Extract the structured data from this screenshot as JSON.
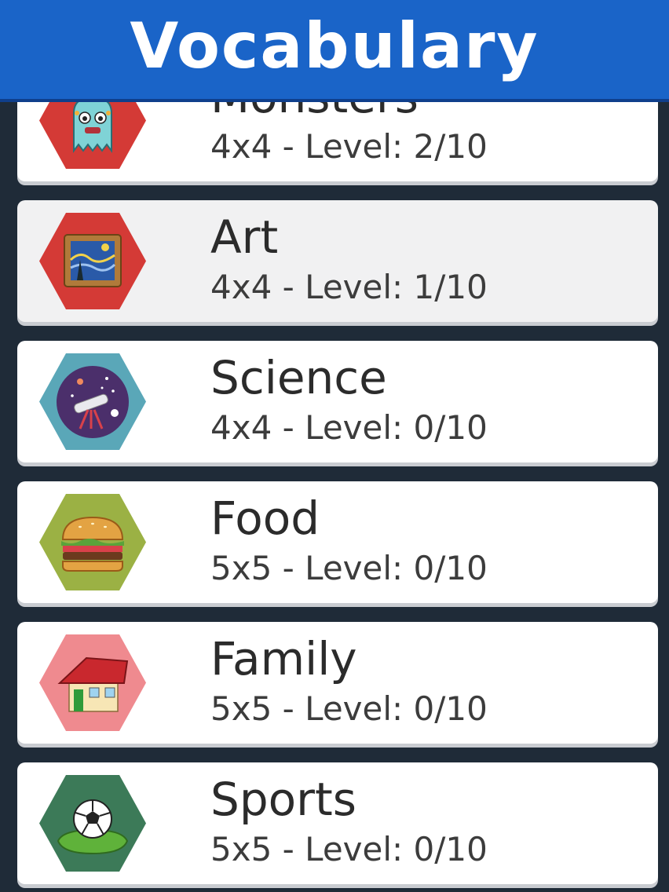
{
  "header": {
    "title": "Vocabulary",
    "background": "#1a64c8"
  },
  "categories": [
    {
      "title": "Monsters",
      "subtitle": "4x4 - Level: 2/10",
      "icon": "monster-icon",
      "hex_color": "#d43a36"
    },
    {
      "title": "Art",
      "subtitle": "4x4 - Level: 1/10",
      "icon": "painting-icon",
      "hex_color": "#d43a36"
    },
    {
      "title": "Science",
      "subtitle": "4x4 - Level: 0/10",
      "icon": "telescope-icon",
      "hex_color": "#5aa7b8"
    },
    {
      "title": "Food",
      "subtitle": "5x5 - Level: 0/10",
      "icon": "burger-icon",
      "hex_color": "#9bb144"
    },
    {
      "title": "Family",
      "subtitle": "5x5 - Level: 0/10",
      "icon": "house-icon",
      "hex_color": "#ef8a8f"
    },
    {
      "title": "Sports",
      "subtitle": "5x5 - Level: 0/10",
      "icon": "soccer-ball-icon",
      "hex_color": "#3c7a58"
    }
  ]
}
